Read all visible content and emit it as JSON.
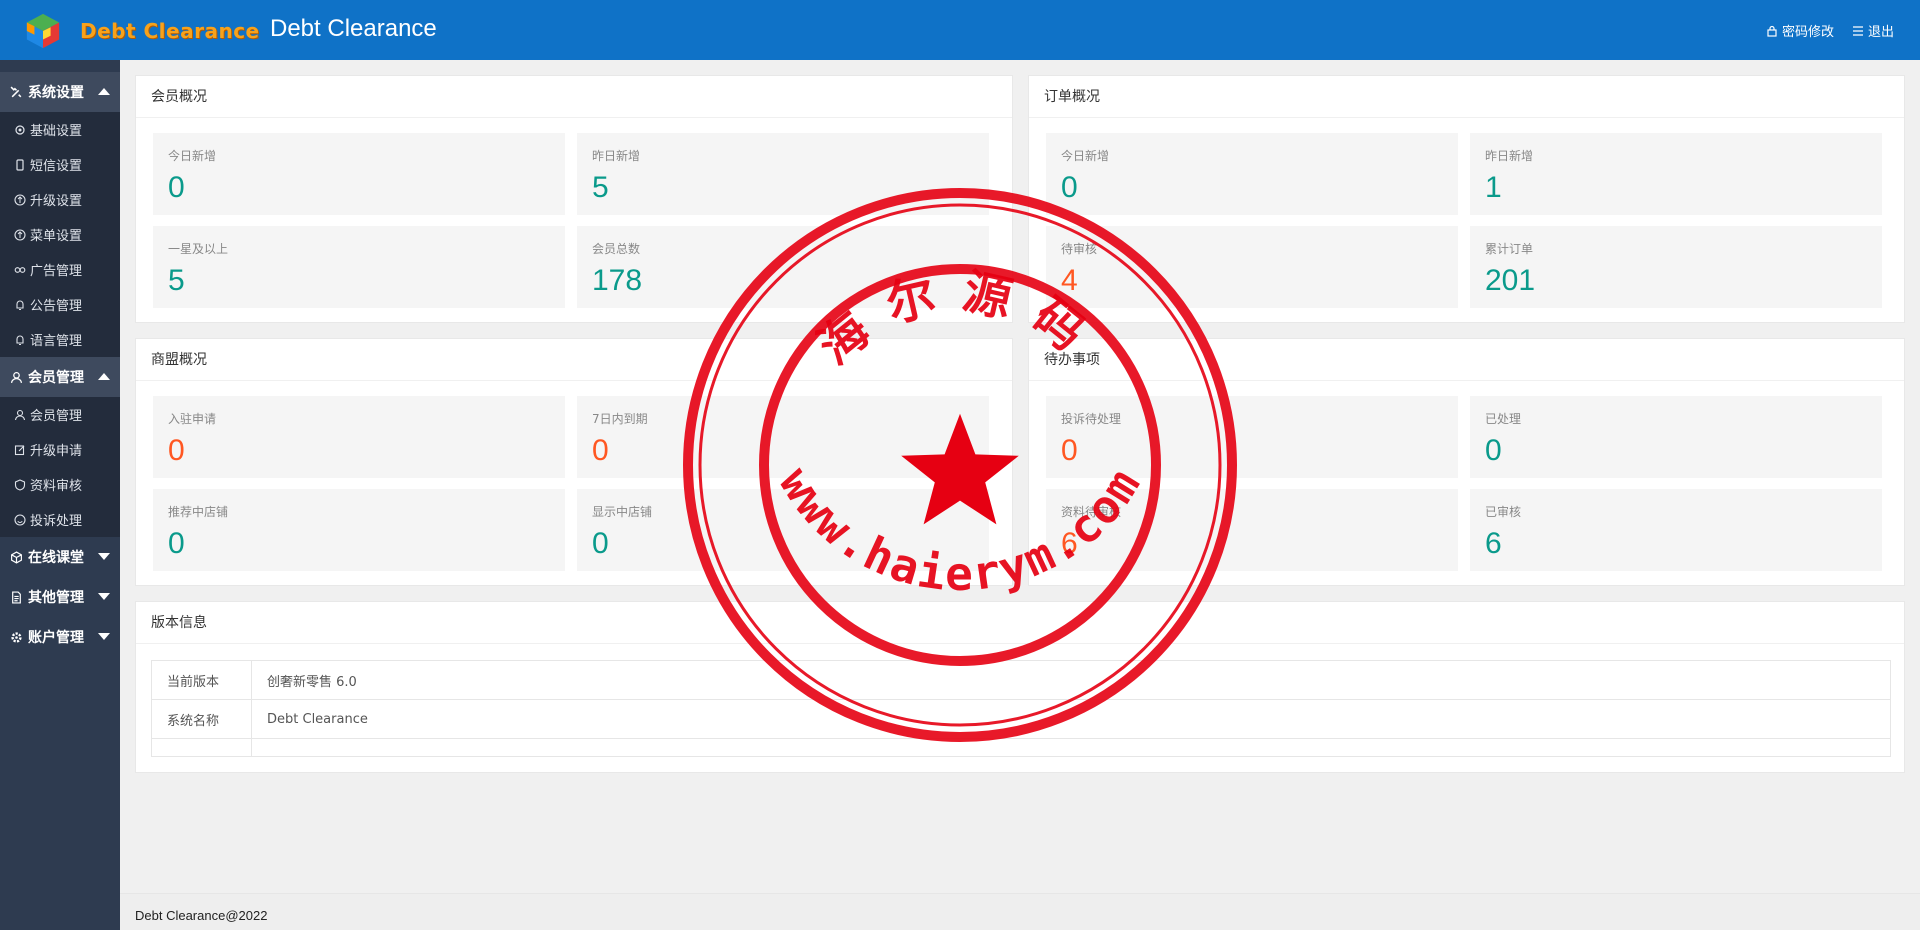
{
  "header": {
    "logo_text": "Debt Clearance",
    "title": "Debt Clearance",
    "change_password": "密码修改",
    "logout": "退出"
  },
  "sidebar": {
    "groups": [
      {
        "label": "系统设置",
        "expanded": true,
        "items": [
          "基础设置",
          "短信设置",
          "升级设置",
          "菜单设置",
          "广告管理",
          "公告管理",
          "语言管理"
        ]
      },
      {
        "label": "会员管理",
        "expanded": true,
        "items": [
          "会员管理",
          "升级申请",
          "资料审核",
          "投诉处理"
        ]
      },
      {
        "label": "在线课堂",
        "expanded": false,
        "items": []
      },
      {
        "label": "其他管理",
        "expanded": false,
        "items": []
      },
      {
        "label": "账户管理",
        "expanded": false,
        "items": []
      }
    ]
  },
  "members": {
    "title": "会员概况",
    "stats": [
      {
        "label": "今日新增",
        "value": "0"
      },
      {
        "label": "昨日新增",
        "value": "5"
      },
      {
        "label": "一星及以上",
        "value": "5"
      },
      {
        "label": "会员总数",
        "value": "178"
      }
    ]
  },
  "orders": {
    "title": "订单概况",
    "stats": [
      {
        "label": "今日新增",
        "value": "0"
      },
      {
        "label": "昨日新增",
        "value": "1"
      },
      {
        "label": "待审核",
        "value": "4"
      },
      {
        "label": "累计订单",
        "value": "201"
      }
    ]
  },
  "merchants": {
    "title": "商盟概况",
    "stats": [
      {
        "label": "入驻申请",
        "value": "0"
      },
      {
        "label": "7日内到期",
        "value": "0"
      },
      {
        "label": "推荐中店铺",
        "value": "0"
      },
      {
        "label": "显示中店铺",
        "value": "0"
      }
    ]
  },
  "todo": {
    "title": "待办事项",
    "stats": [
      {
        "label": "投诉待处理",
        "value": "0"
      },
      {
        "label": "已处理",
        "value": "0"
      },
      {
        "label": "资料待审核",
        "value": "6"
      },
      {
        "label": "已审核",
        "value": "6"
      }
    ]
  },
  "version": {
    "title": "版本信息",
    "rows": [
      {
        "key": "当前版本",
        "value": "创奢新零售 6.0"
      },
      {
        "key": "系统名称",
        "value": "Debt Clearance"
      }
    ]
  },
  "footer": {
    "text": "Debt Clearance@2022"
  },
  "watermark": {
    "top_text": "海尔源码",
    "bottom_text": "www.haierym.com"
  },
  "colors": {
    "header": "#0f72c7",
    "sidebar": "#2e3b50",
    "teal": "#0a9a8b",
    "orange": "#ff5722",
    "stamp": "#e60012"
  }
}
